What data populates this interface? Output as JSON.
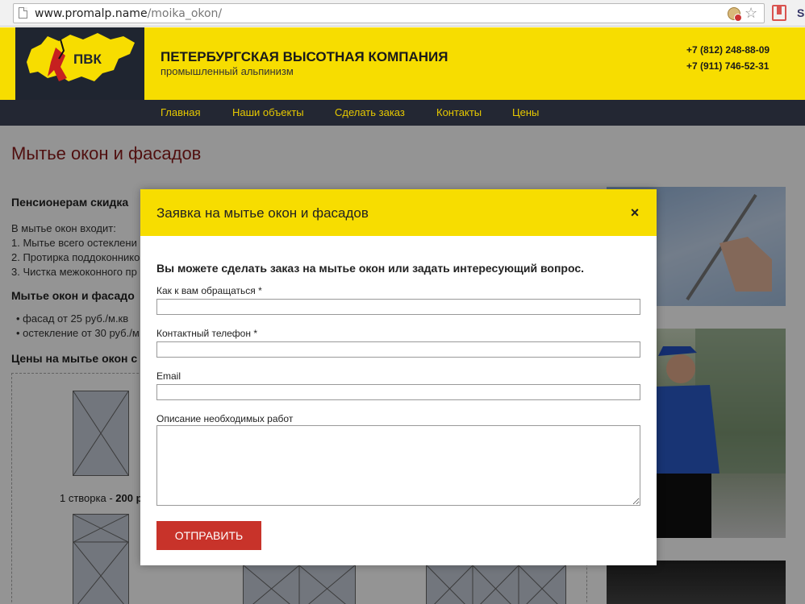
{
  "browser": {
    "url_domain": "www.promalp.name",
    "url_path": "/moika_okon/"
  },
  "site": {
    "logo_text": "ПВК",
    "title": "ПЕТЕРБУРГСКАЯ ВЫСОТНАЯ КОМПАНИЯ",
    "subtitle": "промышленный альпинизм",
    "phone_1": "+7 (812) 248-88-09",
    "phone_2": "+7 (911) 746-52-31",
    "menu": [
      "Главная",
      "Наши объекты",
      "Сделать заказ",
      "Контакты",
      "Цены"
    ]
  },
  "content": {
    "page_title": "Мытье окон и фасадов",
    "pensioners": "Пенсионерам скидка",
    "includes": "В мытье окон входит:",
    "list": [
      "1.  Мытье всего остеклени",
      "2.  Протирка поддоконнико",
      "3.  Чистка межоконного пр"
    ],
    "section_facade": "Мытье окон и фасадо",
    "prices": [
      "фасад от 25 руб./м.кв",
      "остекление от 30 руб./м"
    ],
    "section_prices": "Цены на мытье окон с",
    "window_label_prefix": "1 створка - ",
    "window_label_price": "200 р"
  },
  "modal": {
    "title": "Заявка на мытье окон и фасадов",
    "close": "×",
    "lead": "Вы можете сделать заказ на мытье окон или задать интересующий вопрос.",
    "name_label": "Как к вам обращаться *",
    "phone_label": "Контактный телефон *",
    "email_label": "Email",
    "desc_label": "Описание необходимых работ",
    "submit": "ОТПРАВИТЬ"
  },
  "colors": {
    "brand_yellow": "#f7dd00",
    "nav_dark": "#232733",
    "accent_red": "#c8332a",
    "title_red": "#8b1a1a"
  }
}
